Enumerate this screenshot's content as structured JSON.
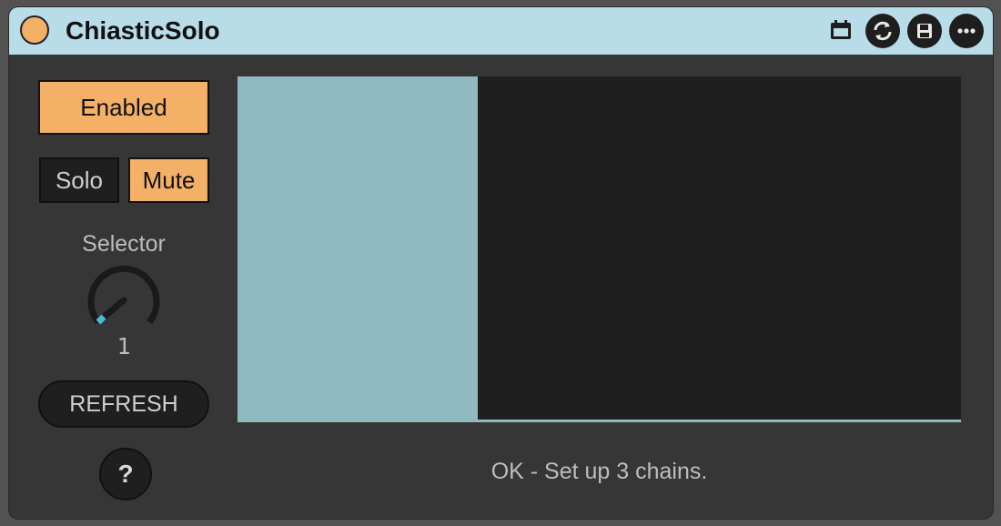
{
  "device": {
    "title": "ChiasticSolo",
    "fold_color": "#f2b066",
    "titlebar_color": "#b8dce8"
  },
  "titlebar_icons": [
    "calendar-icon",
    "refresh-cycle-icon",
    "save-icon",
    "more-icon"
  ],
  "controls": {
    "enabled_label": "Enabled",
    "solo_label": "Solo",
    "mute_label": "Mute",
    "selector_label": "Selector",
    "selector_value": "1",
    "refresh_label": "REFRESH",
    "help_label": "?"
  },
  "status": {
    "message": "OK - Set up 3 chains."
  },
  "colors": {
    "accent": "#f4b066",
    "panel_highlight": "#8fbac2",
    "knob_indicator": "#4fb8d8"
  }
}
